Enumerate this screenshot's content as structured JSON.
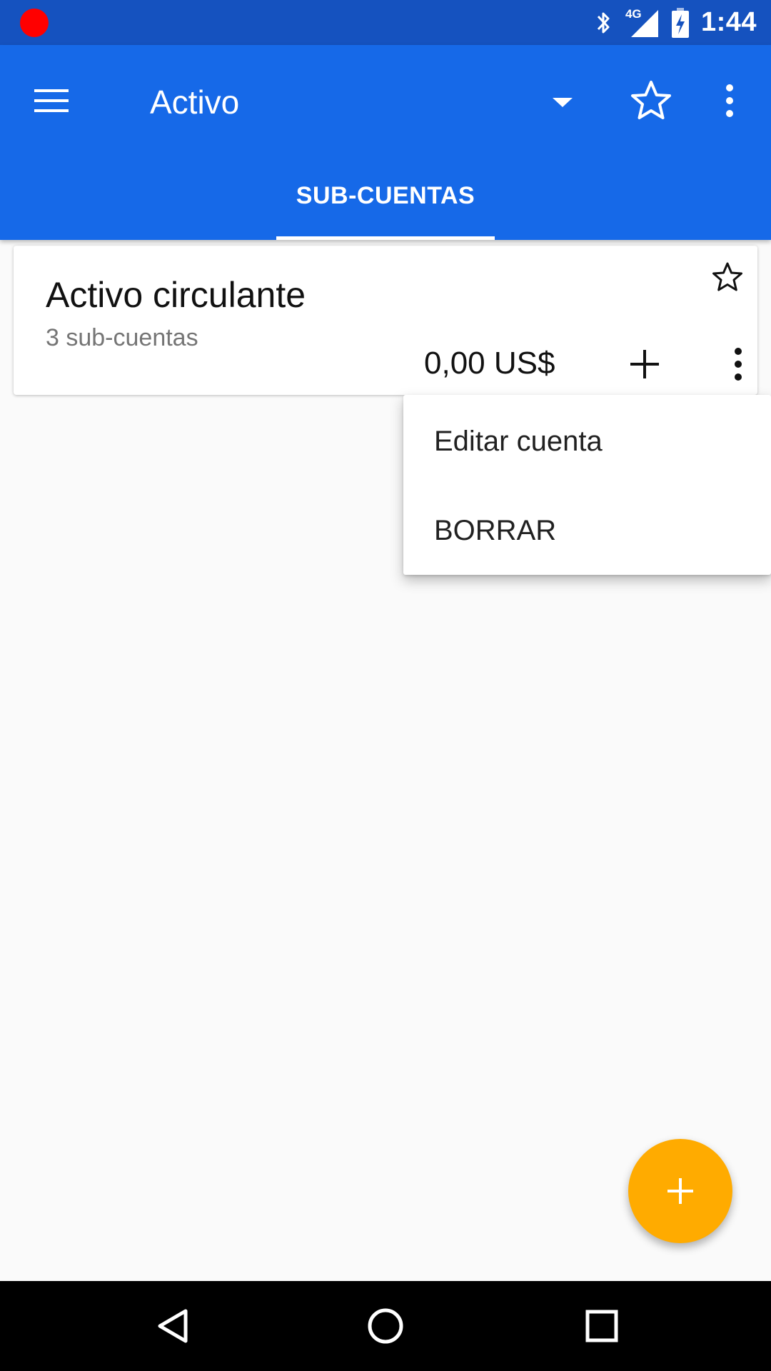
{
  "status_bar": {
    "network": "4G",
    "time": "1:44"
  },
  "app_bar": {
    "title": "Activo",
    "icons": [
      "menu-icon",
      "dropdown-icon",
      "star-outline-icon",
      "overflow-menu-icon"
    ]
  },
  "tabs": [
    {
      "label": "SUB-CUENTAS",
      "selected": true
    }
  ],
  "accounts": [
    {
      "name": "Activo circulante",
      "subtitle": "3 sub-cuentas",
      "balance": "0,00 US$",
      "favorite": false
    }
  ],
  "popup_menu": {
    "items": [
      {
        "label": "Editar cuenta"
      },
      {
        "label": "BORRAR"
      }
    ]
  },
  "colors": {
    "status_bar": "#1552bf",
    "primary": "#1669e8",
    "fab": "#ffab00",
    "background": "#fafafa",
    "recording_dot": "#ff0000"
  }
}
